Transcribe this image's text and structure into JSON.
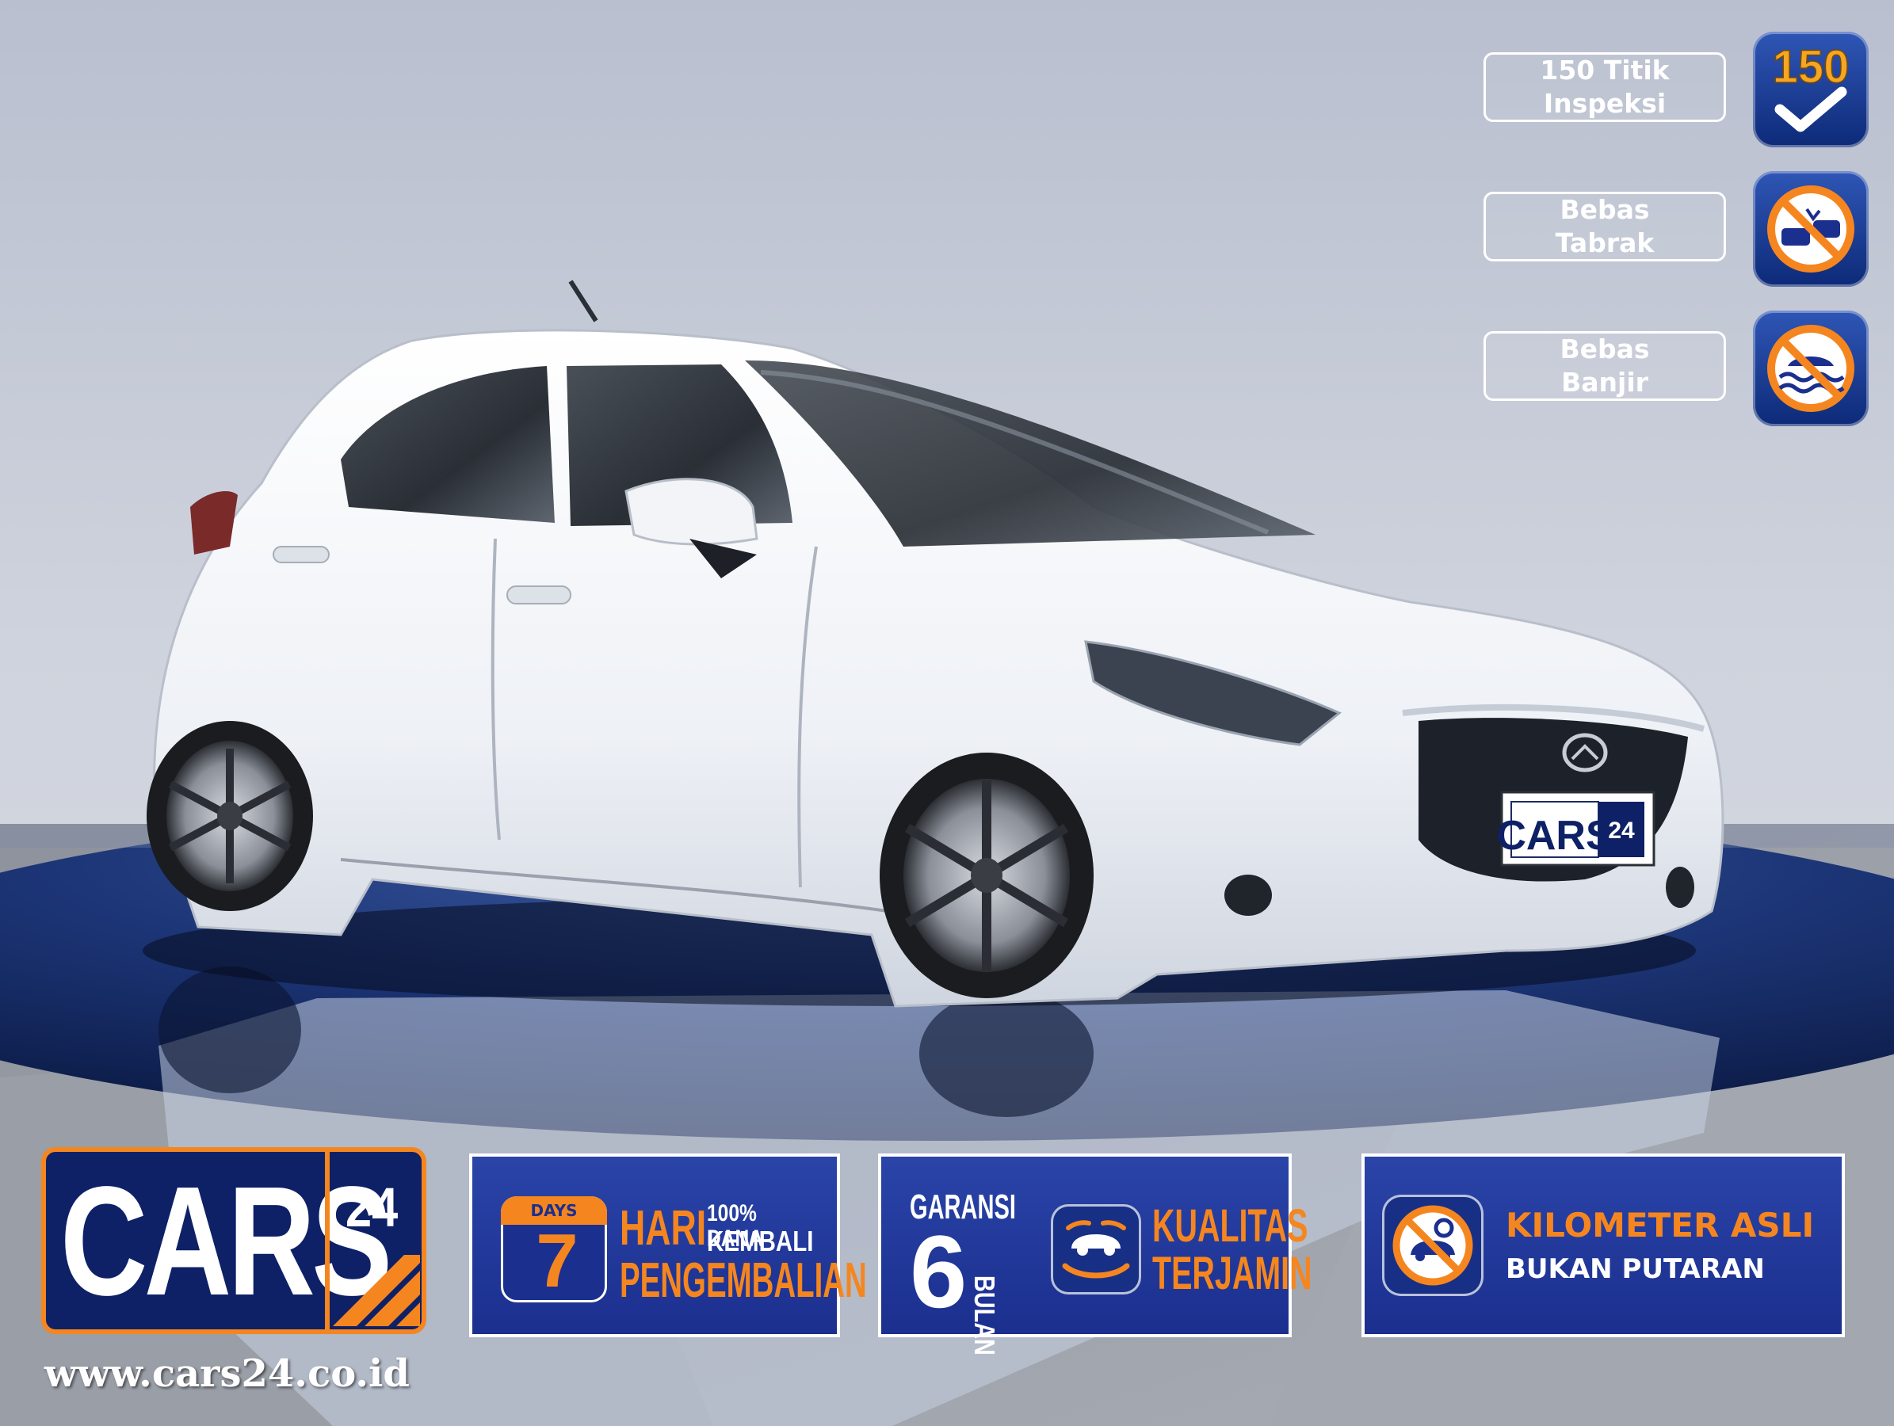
{
  "badges": [
    {
      "line1": "150 Titik",
      "line2": "Inspeksi",
      "icon": "inspection-150-check-icon",
      "icon_text": "150"
    },
    {
      "line1": "Bebas",
      "line2": "Tabrak",
      "icon": "no-collision-icon"
    },
    {
      "line1": "Bebas",
      "line2": "Banjir",
      "icon": "no-flood-icon"
    }
  ],
  "logo": {
    "brand": "CARS",
    "number": "24"
  },
  "plate": {
    "brand": "CARS",
    "number": "24"
  },
  "website": "www.cars24.co.id",
  "banner_days": {
    "days_label": "DAYS",
    "days_number": "7",
    "line1": "HARI",
    "line2": "PENGEMBALIAN",
    "refund_line1": "100% DANA",
    "refund_line2": "KEMBALI"
  },
  "banner_warranty": {
    "garansi": "GARANSI",
    "number": "6",
    "bulan": "BULAN",
    "quality_line1": "KUALITAS",
    "quality_line2": "TERJAMIN"
  },
  "banner_km": {
    "line1": "KILOMETER ASLI",
    "line2": "BUKAN PUTARAN"
  },
  "colors": {
    "brand_navy": "#0e2167",
    "brand_orange": "#f5861f",
    "banner_blue": "#1b2f8e",
    "car_white": "#f4f6fa"
  }
}
